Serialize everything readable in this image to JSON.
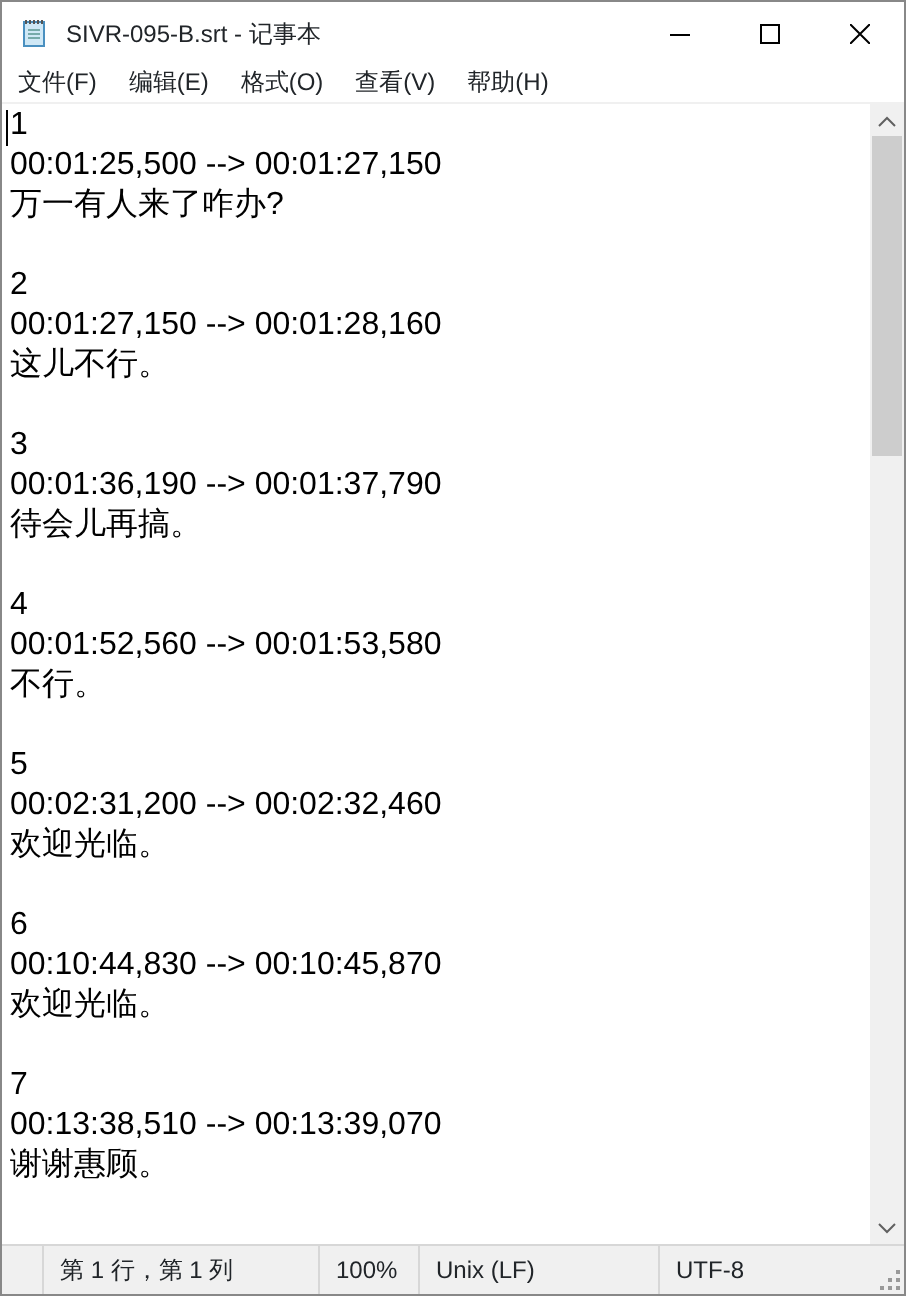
{
  "window": {
    "title": "SIVR-095-B.srt - 记事本"
  },
  "menu": [
    "文件(F)",
    "编辑(E)",
    "格式(O)",
    "查看(V)",
    "帮助(H)"
  ],
  "entries": [
    {
      "index": "1",
      "timing": "00:01:25,500 --> 00:01:27,150",
      "text": "万一有人来了咋办?"
    },
    {
      "index": "2",
      "timing": "00:01:27,150 --> 00:01:28,160",
      "text": "这儿不行。"
    },
    {
      "index": "3",
      "timing": "00:01:36,190 --> 00:01:37,790",
      "text": "待会儿再搞。"
    },
    {
      "index": "4",
      "timing": "00:01:52,560 --> 00:01:53,580",
      "text": "不行。"
    },
    {
      "index": "5",
      "timing": "00:02:31,200 --> 00:02:32,460",
      "text": "欢迎光临。"
    },
    {
      "index": "6",
      "timing": "00:10:44,830 --> 00:10:45,870",
      "text": "欢迎光临。"
    },
    {
      "index": "7",
      "timing": "00:13:38,510 --> 00:13:39,070",
      "text": "谢谢惠顾。"
    }
  ],
  "status_bar": {
    "position": "第 1 行，第 1 列",
    "zoom": "100%",
    "line_ending": "Unix (LF)",
    "encoding": "UTF-8"
  }
}
